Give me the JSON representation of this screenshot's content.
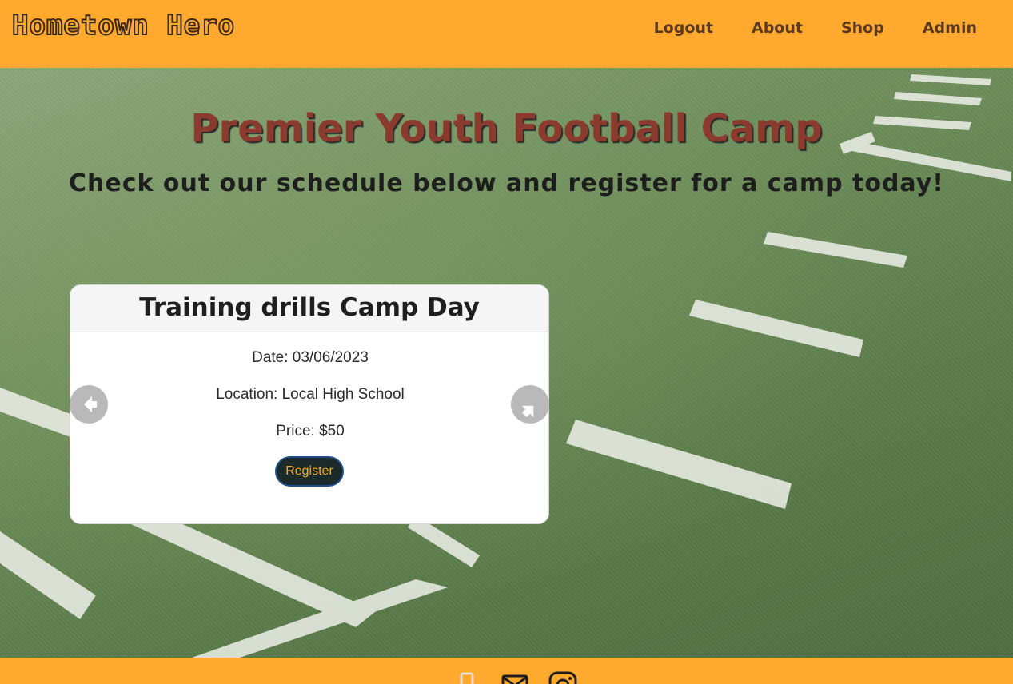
{
  "brand": "Hometown Hero",
  "nav": {
    "items": [
      {
        "label": "Logout"
      },
      {
        "label": "About"
      },
      {
        "label": "Shop"
      },
      {
        "label": "Admin"
      }
    ]
  },
  "hero": {
    "title": "Premier Youth Football Camp",
    "subtitle": "Check out our schedule below and register for a camp today!"
  },
  "camp_card": {
    "title": "Training drills Camp Day",
    "date": "Date: 03/06/2023",
    "location": "Location: Local High School",
    "price": "Price: $50",
    "register_label": "Register"
  },
  "carousel": {
    "prev_icon": "arrow-left-icon",
    "next_icon": "arrow-right-icon"
  },
  "footer": {
    "icons": [
      "phone-icon",
      "mail-icon",
      "instagram-icon"
    ]
  },
  "colors": {
    "navbar_bg": "#ffa92f",
    "title_red": "#8b3a2e",
    "button_bg": "#1c2b2a",
    "button_text": "#f0a830"
  }
}
